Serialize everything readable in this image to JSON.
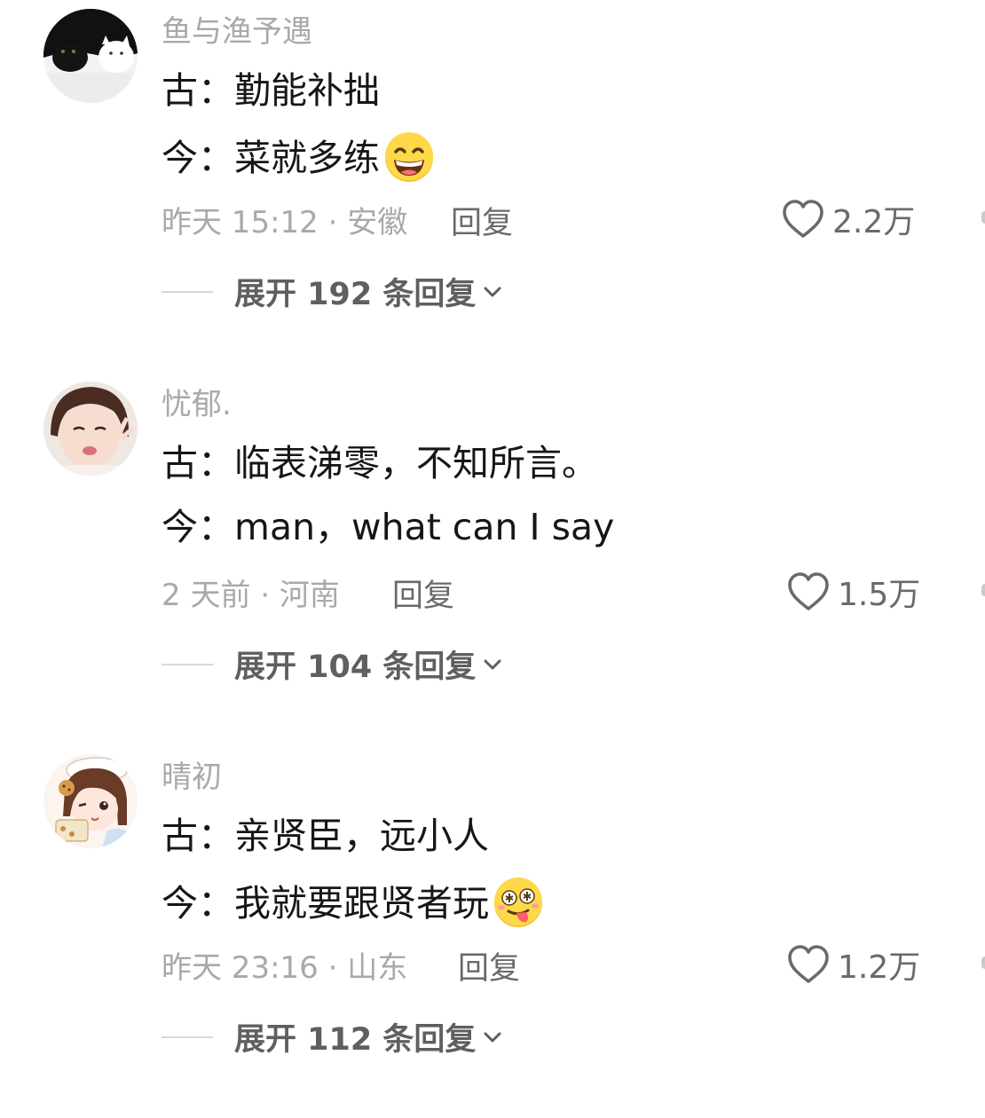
{
  "comments": [
    {
      "username": "鱼与渔予遇",
      "line1": "古：勤能补拙",
      "line2": "今：菜就多练",
      "line2_emoji": "grinning-face-icon",
      "meta": "昨天 15:12 · 安徽",
      "reply_label": "回复",
      "likes": "2.2万",
      "expand_label": "展开 192 条回复"
    },
    {
      "username": "忧郁.",
      "line1": "古：临表涕零，不知所言。",
      "line2": "今：man，what can I say",
      "meta": "2 天前 · 河南",
      "reply_label": "回复",
      "likes": "1.5万",
      "expand_label": "展开 104 条回复"
    },
    {
      "username": "晴初",
      "line1": "古：亲贤臣，远小人",
      "line2": "今：我就要跟贤者玩",
      "line2_emoji": "dizzy-tongue-face-icon",
      "meta": "昨天 23:16 · 山东",
      "reply_label": "回复",
      "likes": "1.2万",
      "expand_label": "展开 112 条回复"
    }
  ],
  "colors": {
    "username": "#a9a9a9",
    "content": "#161616",
    "meta": "#a9a9a9",
    "action": "#6a6a6a",
    "expand": "#5f5f5f"
  }
}
